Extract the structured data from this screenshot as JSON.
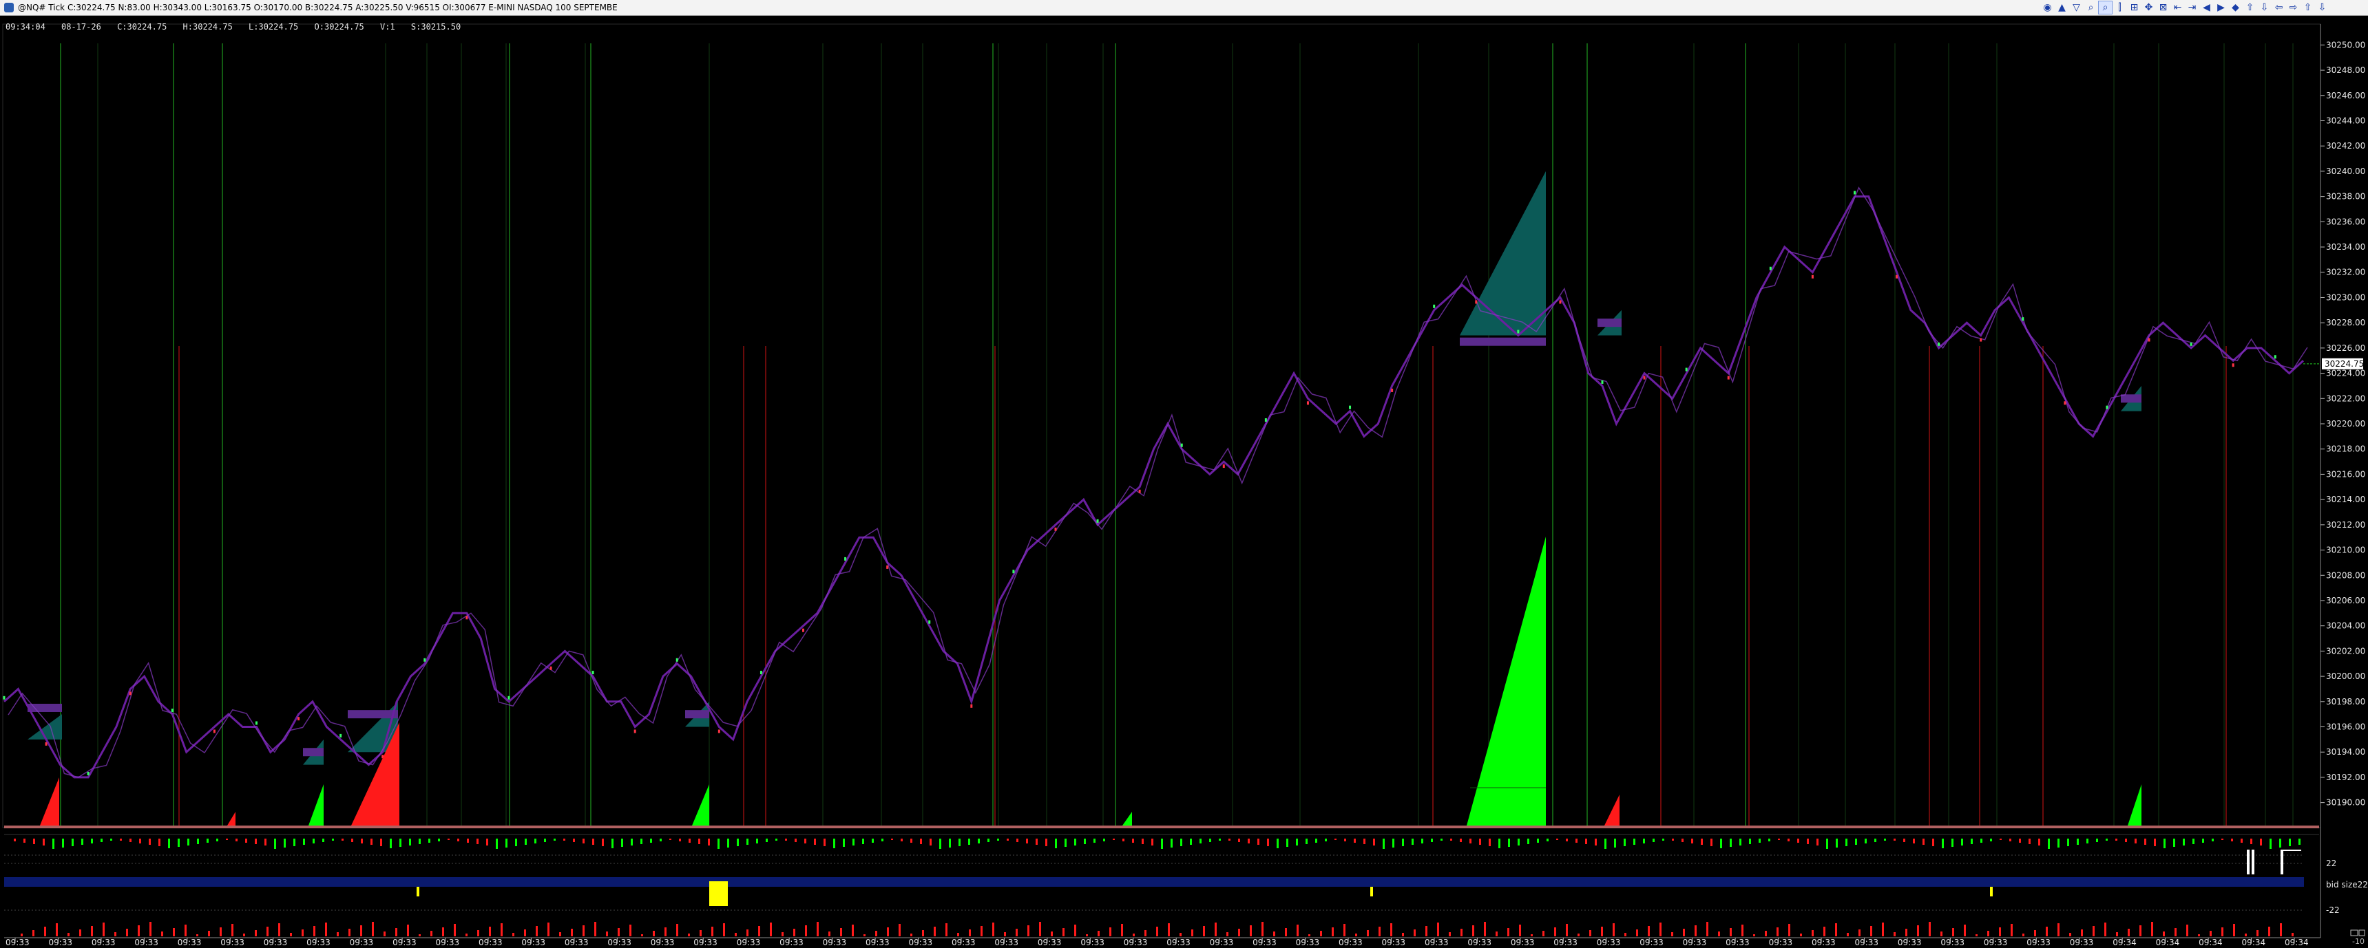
{
  "window": {
    "title": "@NQ# Tick C:30224.75 N:83.00 H:30343.00 L:30163.75 O:30170.00 B:30224.75 A:30225.50 V:96515 OI:300677 E-MINI NASDAQ 100 SEPTEMBE"
  },
  "toolbar": {
    "icons": [
      "color-icon",
      "cursor-icon",
      "draw-icon",
      "zoom-in-icon",
      "zoom-out-icon",
      "bars-icon",
      "scale-icon",
      "move-icon",
      "fit-icon",
      "step-back-icon",
      "step-forward-icon",
      "page-back-icon",
      "page-forward-icon",
      "center-icon",
      "arrow-up-icon",
      "arrow-down-icon",
      "scroll-left-icon",
      "scroll-right-icon",
      "scroll-up-icon",
      "scroll-down-icon"
    ],
    "glyphs": [
      "◉",
      "▲",
      "▽",
      "⌕",
      "⌕",
      "⫿",
      "⊞",
      "✥",
      "⊠",
      "⇤",
      "⇥",
      "◀",
      "▶",
      "◆",
      "⇧",
      "⇩",
      "⇦",
      "⇨",
      "⇧",
      "⇩"
    ]
  },
  "cursor_data": {
    "time": "09:34:04",
    "date": "08-17-26",
    "close": "C:30224.75",
    "high": "H:30224.75",
    "low": "L:30224.75",
    "open": "O:30224.75",
    "volume": "V:1",
    "extra": "S:30215.50"
  },
  "colors": {
    "background": "#000000",
    "price_line": "#6a1fa0",
    "up_marker": "#33ff66",
    "down_marker": "#ff3344",
    "volume_up": "#00ff00",
    "volume_down": "#ff1a1a",
    "profile_teal": "#0b5a57",
    "profile_purple": "#5a2a8c",
    "band_blue": "#0a1a6e",
    "accent_yellow": "#ffff00",
    "axis_text": "#e6e6e6",
    "price_box": "#ffffff"
  },
  "indicator_labels": {
    "pane2_upper": "22",
    "pane2_mid": "bid size22",
    "pane2_lower": "-22"
  },
  "last_price_label": "30224.75",
  "corner_label": "-10",
  "chart_data": {
    "type": "line",
    "title": "",
    "xlabel": "",
    "ylabel": "",
    "ylim": [
      30189,
      30251
    ],
    "y_ticks": [
      30190,
      30192,
      30194,
      30196,
      30198,
      30200,
      30202,
      30204,
      30206,
      30208,
      30210,
      30212,
      30214,
      30216,
      30218,
      30220,
      30222,
      30224,
      30226,
      30228,
      30230,
      30232,
      30234,
      30236,
      30238,
      30240,
      30242,
      30244,
      30246,
      30248,
      30250
    ],
    "y_tick_labels": [
      "30190.00",
      "30192.00",
      "30194.00",
      "30196.00",
      "30198.00",
      "30200.00",
      "30202.00",
      "30204.00",
      "30206.00",
      "30208.00",
      "30210.00",
      "30212.00",
      "30214.00",
      "30216.00",
      "30218.00",
      "30220.00",
      "30222.00",
      "30224.00",
      "30226.00",
      "30228.00",
      "30230.00",
      "30232.00",
      "30234.00",
      "30236.00",
      "30238.00",
      "30240.00",
      "30242.00",
      "30244.00",
      "30246.00",
      "30248.00",
      "30250.00"
    ],
    "x_tick_labels": [
      "09:33",
      "09:33",
      "09:33",
      "09:33",
      "09:33",
      "09:33",
      "09:33",
      "09:33",
      "09:33",
      "09:33",
      "09:33",
      "09:33",
      "09:33",
      "09:33",
      "09:33",
      "09:33",
      "09:33",
      "09:33",
      "09:33",
      "09:33",
      "09:33",
      "09:33",
      "09:33",
      "09:33",
      "09:33",
      "09:33",
      "09:33",
      "09:33",
      "09:33",
      "09:33",
      "09:33",
      "09:33",
      "09:33",
      "09:33",
      "09:33",
      "09:33",
      "09:33",
      "09:33",
      "09:33",
      "09:33",
      "09:33",
      "09:33",
      "09:33",
      "09:33",
      "09:33",
      "09:33",
      "09:33",
      "09:33",
      "09:33",
      "09:34",
      "09:34",
      "09:34",
      "09:34",
      "09:34"
    ],
    "last_price": 30224.75,
    "series": [
      {
        "values": [
          30198,
          30199,
          30197,
          30195,
          30193,
          30192,
          30192,
          30194,
          30196,
          30199,
          30200,
          30198,
          30197,
          30194,
          30195,
          30196,
          30197,
          30196,
          30196,
          30194,
          30195,
          30197,
          30198,
          30196,
          30195,
          30194,
          30193,
          30194,
          30198,
          30200,
          30201,
          30203,
          30205,
          30205,
          30203,
          30199,
          30198,
          30199,
          30200,
          30201,
          30202,
          30201,
          30200,
          30198,
          30198,
          30196,
          30197,
          30200,
          30201,
          30200,
          30198,
          30196,
          30195,
          30198,
          30200,
          30202,
          30203,
          30204,
          30205,
          30207,
          30209,
          30211,
          30211,
          30209,
          30208,
          30206,
          30204,
          30202,
          30201,
          30198,
          30202,
          30206,
          30208,
          30210,
          30211,
          30212,
          30213,
          30214,
          30212,
          30213,
          30214,
          30215,
          30218,
          30220,
          30218,
          30217,
          30216,
          30217,
          30216,
          30218,
          30220,
          30222,
          30224,
          30222,
          30221,
          30220,
          30221,
          30219,
          30220,
          30223,
          30225,
          30227,
          30229,
          30230,
          30231,
          30230,
          30229,
          30228,
          30227,
          30228,
          30229,
          30230,
          30228,
          30224,
          30223,
          30220,
          30222,
          30224,
          30223,
          30222,
          30224,
          30226,
          30225,
          30224,
          30227,
          30230,
          30232,
          30234,
          30233,
          30232,
          30234,
          30236,
          30238,
          30238,
          30235,
          30232,
          30229,
          30228,
          30226,
          30227,
          30228,
          30227,
          30229,
          30230,
          30228,
          30226,
          30224,
          30222,
          30220,
          30219,
          30221,
          30223,
          30225,
          30227,
          30228,
          30227,
          30226,
          30227,
          30226,
          30225,
          30226,
          30226,
          30225,
          30224,
          30225
        ]
      }
    ]
  }
}
